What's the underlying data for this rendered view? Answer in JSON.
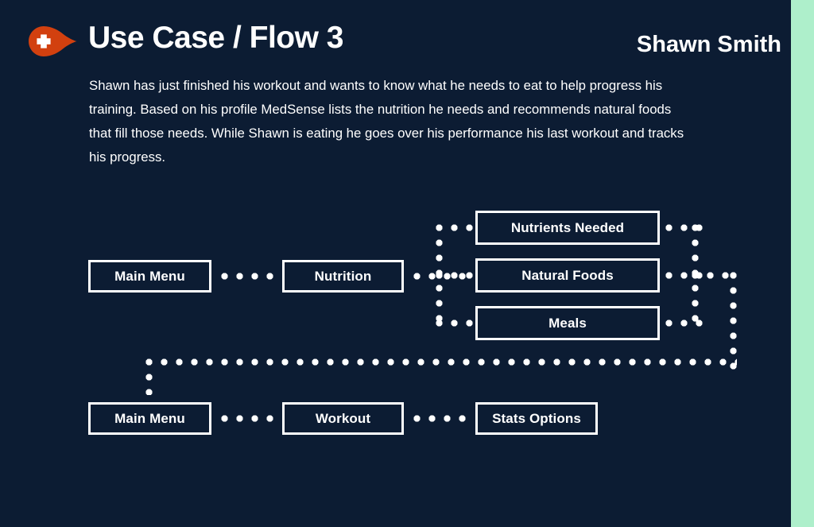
{
  "slide": {
    "background_color": "#0c1c33",
    "accent_strip_color": "#aeefcb"
  },
  "header": {
    "logo_icon": "medsense-droplet-plus-logo",
    "logo_color": "#d2400f",
    "title": "Use Case / Flow 3",
    "person_name": "Shawn Smith"
  },
  "description": {
    "text": "Shawn has just finished his workout and wants to know what he needs to eat to help progress his training. Based on his profile MedSense lists the nutrition he needs and recommends natural foods that fill those needs. While Shawn is eating he goes over his performance his last workout and tracks his progress."
  },
  "flow": {
    "nodes": [
      {
        "id": "main-menu-top",
        "label": "Main Menu"
      },
      {
        "id": "nutrition",
        "label": "Nutrition"
      },
      {
        "id": "nutrients-needed",
        "label": "Nutrients Needed"
      },
      {
        "id": "natural-foods",
        "label": "Natural Foods"
      },
      {
        "id": "meals",
        "label": "Meals"
      },
      {
        "id": "main-menu-bottom",
        "label": "Main Menu"
      },
      {
        "id": "workout",
        "label": "Workout"
      },
      {
        "id": "stats-options",
        "label": "Stats Options"
      }
    ],
    "connector_style": "dotted",
    "connector_color": "#ffffff"
  }
}
